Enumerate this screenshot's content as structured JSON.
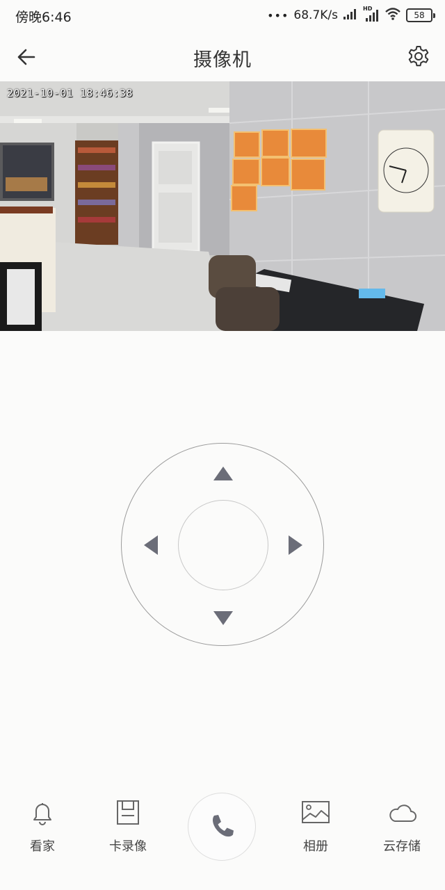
{
  "status_bar": {
    "time": "傍晚6:46",
    "network_speed": "68.7K/s",
    "hd_label": "HD",
    "battery": "58"
  },
  "header": {
    "title": "摄像机",
    "back_icon": "arrow-left-icon",
    "settings_icon": "gear-icon"
  },
  "video": {
    "timestamp": "2021-10-01 18:46:38"
  },
  "ptz": {
    "up_icon": "triangle-up-icon",
    "down_icon": "triangle-down-icon",
    "left_icon": "triangle-left-icon",
    "right_icon": "triangle-right-icon"
  },
  "bottom_nav": {
    "items": [
      {
        "label": "看家",
        "icon": "bell-icon"
      },
      {
        "label": "卡录像",
        "icon": "sd-card-icon"
      },
      {
        "label": "",
        "icon": "phone-icon"
      },
      {
        "label": "相册",
        "icon": "image-icon"
      },
      {
        "label": "云存储",
        "icon": "cloud-icon"
      }
    ]
  },
  "colors": {
    "background": "#fbfbfa",
    "icon_gray": "#666666",
    "arrow_gray": "#6b6d78",
    "ring_gray": "#9b9b9b"
  }
}
